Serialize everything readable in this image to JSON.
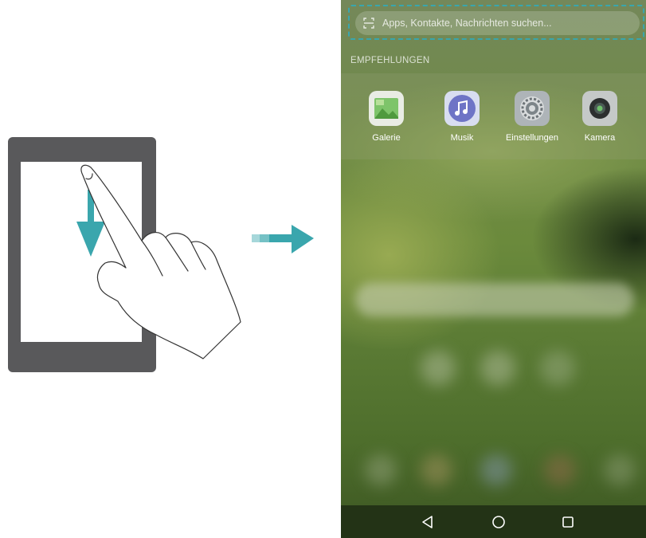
{
  "search": {
    "placeholder": "Apps, Kontakte, Nachrichten suchen..."
  },
  "recommendations": {
    "title": "EMPFEHLUNGEN",
    "apps": [
      {
        "label": "Galerie",
        "icon": "gallery-icon"
      },
      {
        "label": "Musik",
        "icon": "music-icon"
      },
      {
        "label": "Einstellungen",
        "icon": "settings-icon"
      },
      {
        "label": "Kamera",
        "icon": "camera-icon"
      }
    ]
  },
  "navigation": {
    "back": "back-icon",
    "home": "home-icon",
    "recents": "recents-icon"
  },
  "colors": {
    "accent": "#3aa6ad",
    "tablet": "#59595b",
    "navbar": "#233316"
  }
}
